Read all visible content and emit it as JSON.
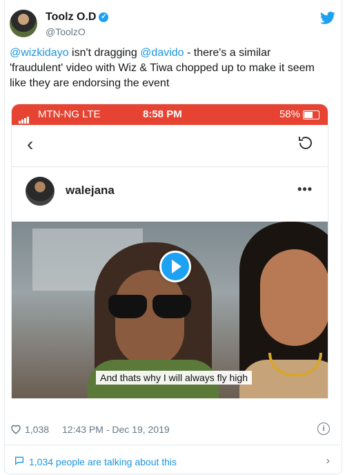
{
  "author": {
    "name": "Toolz O.D",
    "handle": "@ToolzO"
  },
  "tweet": {
    "segments": [
      {
        "text": "@wizkidayo",
        "mention": true
      },
      {
        "text": " isn't dragging ",
        "mention": false
      },
      {
        "text": "@davido",
        "mention": true
      },
      {
        "text": " - there's a similar 'fraudulent' video with Wiz & Tiwa chopped up to make it seem like they are endorsing the event",
        "mention": false
      }
    ]
  },
  "media": {
    "statusbar": {
      "carrier": "MTN-NG  LTE",
      "time": "8:58 PM",
      "battery": "58%"
    },
    "post_user": "walejana",
    "more": "•••",
    "subtitle": "And thats why I will always fly high"
  },
  "stats": {
    "likes": "1,038",
    "timestamp": "12:43 PM - Dec 19, 2019"
  },
  "talk": {
    "label": "1,034 people are talking about this"
  },
  "colors": {
    "accent": "#1da1f2",
    "link": "#1b95e0",
    "statusbar": "#e64332",
    "muted": "#657786"
  },
  "icons": [
    "verified-icon",
    "twitter-bird-icon",
    "back-arrow-icon",
    "reload-icon",
    "play-icon",
    "heart-icon",
    "comment-icon",
    "share-icon",
    "bookmark-icon",
    "info-icon",
    "speech-bubble-icon",
    "chevron-right-icon"
  ]
}
